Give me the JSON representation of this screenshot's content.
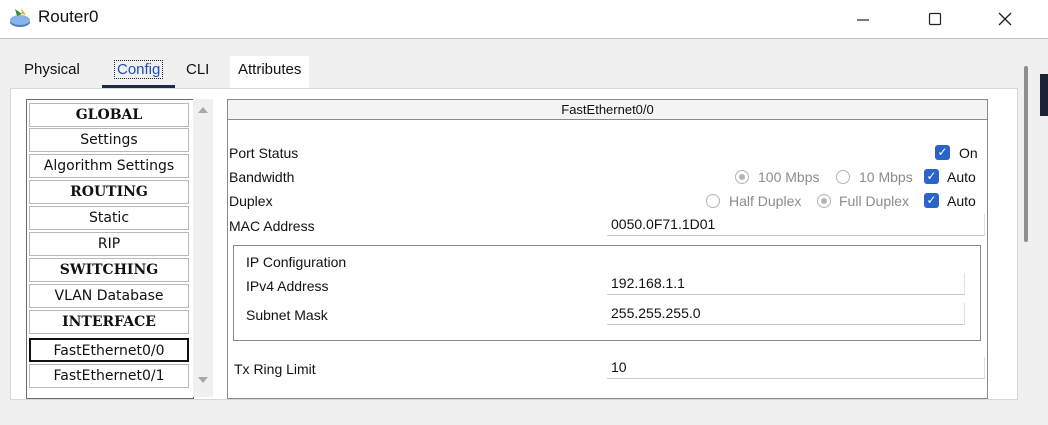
{
  "window": {
    "title": "Router0",
    "app_icon": "router-icon"
  },
  "tabs": [
    {
      "label": "Physical"
    },
    {
      "label": "Config"
    },
    {
      "label": "CLI"
    },
    {
      "label": "Attributes"
    }
  ],
  "sidebar": {
    "items": [
      {
        "label": "GLOBAL"
      },
      {
        "label": "Settings"
      },
      {
        "label": "Algorithm Settings"
      },
      {
        "label": "ROUTING"
      },
      {
        "label": "Static"
      },
      {
        "label": "RIP"
      },
      {
        "label": "SWITCHING"
      },
      {
        "label": "VLAN Database"
      },
      {
        "label": "INTERFACE"
      },
      {
        "label": "FastEthernet0/0"
      },
      {
        "label": "FastEthernet0/1"
      }
    ]
  },
  "interface": {
    "title": "FastEthernet0/0",
    "port_status": {
      "label": "Port Status",
      "on_label": "On"
    },
    "bandwidth": {
      "label": "Bandwidth",
      "opt_100": "100 Mbps",
      "opt_10": "10 Mbps",
      "auto": "Auto"
    },
    "duplex": {
      "label": "Duplex",
      "half": "Half Duplex",
      "full": "Full Duplex",
      "auto": "Auto"
    },
    "mac": {
      "label": "MAC Address",
      "value": "0050.0F71.1D01"
    },
    "ip_config": {
      "heading": "IP Configuration",
      "ipv4": {
        "label": "IPv4 Address",
        "value": "192.168.1.1"
      },
      "mask": {
        "label": "Subnet Mask",
        "value": "255.255.255.0"
      }
    },
    "tx_ring": {
      "label": "Tx Ring Limit",
      "value": "10"
    }
  }
}
